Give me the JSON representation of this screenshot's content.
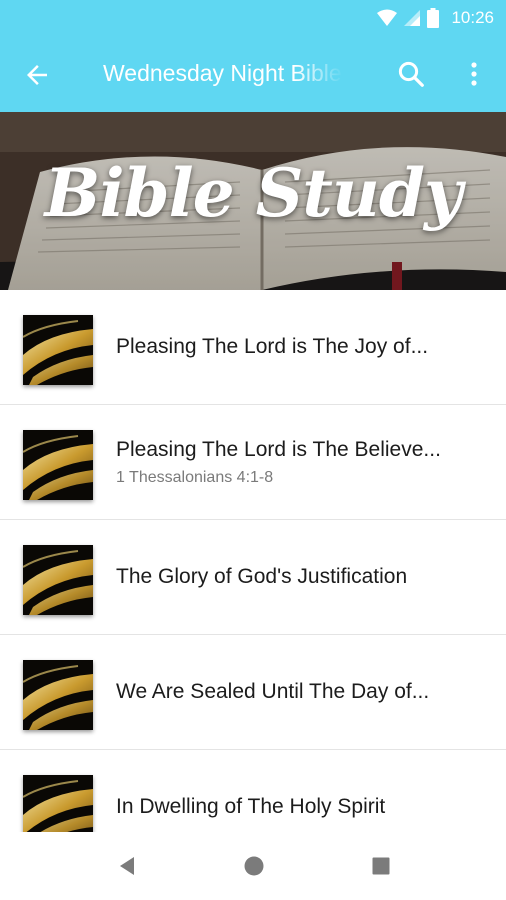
{
  "status_bar": {
    "time": "10:26",
    "icons": [
      "wifi-icon",
      "cell-signal-icon",
      "battery-icon"
    ]
  },
  "app_bar": {
    "title": "Wednesday Night Bible Study",
    "back_icon": "arrow-back-icon",
    "search_icon": "search-icon",
    "more_icon": "more-vert-icon",
    "color": "#5fd7f2"
  },
  "banner": {
    "title": "Bible Study"
  },
  "list": {
    "items": [
      {
        "title": "Pleasing The Lord is The Joy of...",
        "subtitle": ""
      },
      {
        "title": "Pleasing The Lord is The Believe...",
        "subtitle": "1 Thessalonians 4:1-8"
      },
      {
        "title": "The Glory of God's Justification",
        "subtitle": ""
      },
      {
        "title": "We Are Sealed Until The Day of...",
        "subtitle": ""
      },
      {
        "title": "In Dwelling of The Holy Spirit",
        "subtitle": ""
      }
    ]
  },
  "nav_bar": {
    "icons": [
      "back-triangle-icon",
      "home-circle-icon",
      "recents-square-icon"
    ]
  }
}
